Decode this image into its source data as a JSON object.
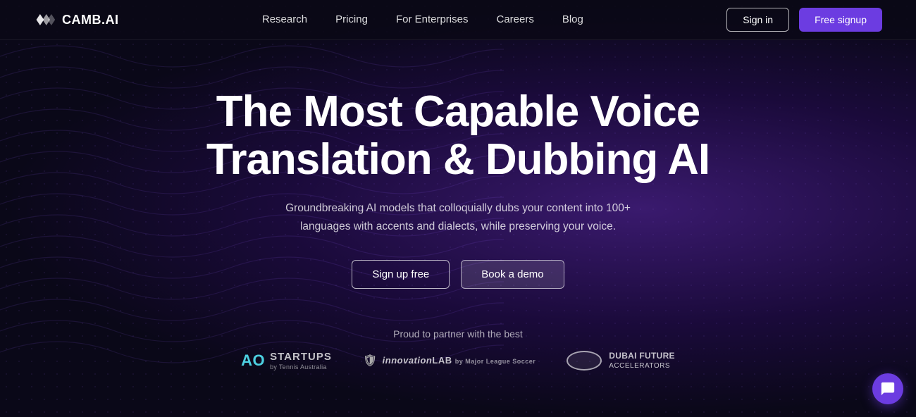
{
  "brand": {
    "name": "CAMB.AI"
  },
  "nav": {
    "links": [
      {
        "label": "Research",
        "href": "#"
      },
      {
        "label": "Pricing",
        "href": "#"
      },
      {
        "label": "For Enterprises",
        "href": "#"
      },
      {
        "label": "Careers",
        "href": "#"
      },
      {
        "label": "Blog",
        "href": "#"
      }
    ],
    "signin_label": "Sign in",
    "signup_label": "Free signup"
  },
  "hero": {
    "title_line1": "The Most Capable Voice",
    "title_line2": "Translation & Dubbing AI",
    "subtitle": "Groundbreaking AI models that colloquially dubs your content into 100+ languages with accents and dialects, while preserving your voice.",
    "cta_primary": "Sign up free",
    "cta_secondary": "Book a demo"
  },
  "partners": {
    "label": "Proud to partner with the best",
    "items": [
      {
        "name": "AO Startups",
        "sub": "by Tennis Australia"
      },
      {
        "name": "innovationLAB",
        "sub": "by Major League Soccer"
      },
      {
        "name": "DUBAI FUTURE ACCELERATORS",
        "sub": ""
      }
    ]
  },
  "colors": {
    "accent": "#6c3ce1",
    "bg_dark": "#0e0b1a",
    "nav_border": "rgba(255,255,255,0.07)"
  }
}
